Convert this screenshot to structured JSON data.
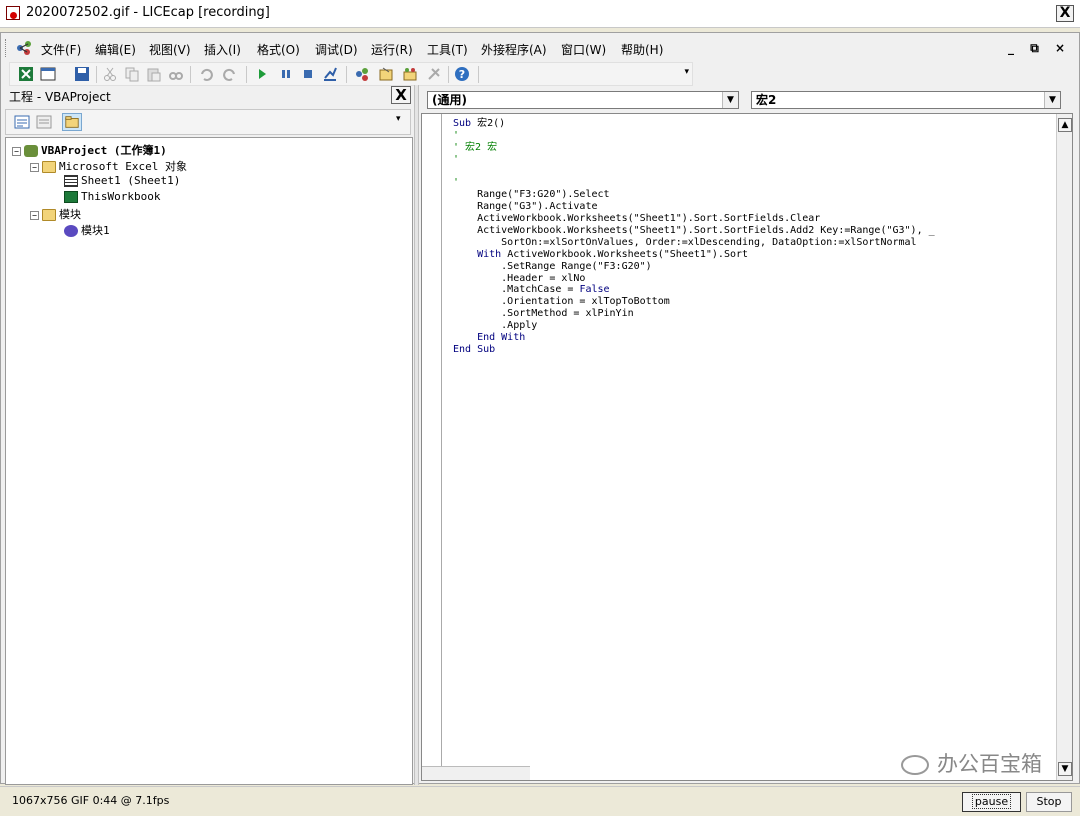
{
  "window": {
    "title": "2020072502.gif - LICEcap [recording]",
    "close_glyph": "X"
  },
  "menubar": {
    "items": [
      "文件(F)",
      "编辑(E)",
      "视图(V)",
      "插入(I)",
      "格式(O)",
      "调试(D)",
      "运行(R)",
      "工具(T)",
      "外接程序(A)",
      "窗口(W)",
      "帮助(H)"
    ],
    "mdi_controls": "_ ⧉ ×"
  },
  "toolbar": {
    "icons": [
      "excel-icon",
      "insert-module-icon",
      "save-icon",
      "cut-icon",
      "copy-icon",
      "paste-icon",
      "find-icon",
      "undo-icon",
      "redo-icon",
      "run-icon",
      "break-icon",
      "reset-icon",
      "design-mode-icon",
      "project-explorer-icon",
      "properties-icon",
      "object-browser-icon",
      "toolbox-icon",
      "help-icon"
    ]
  },
  "project": {
    "title": "工程 - VBAProject",
    "close_glyph": "X",
    "tree": {
      "root": "VBAProject (工作簿1)",
      "excel_objects": "Microsoft Excel 对象",
      "sheet1": "Sheet1 (Sheet1)",
      "thisworkbook": "ThisWorkbook",
      "modules": "模块",
      "module1": "模块1"
    }
  },
  "code_window": {
    "object_combo": "(通用)",
    "proc_combo": "宏2",
    "lines": [
      {
        "t": "Sub 宏2()",
        "k": "sub"
      },
      {
        "t": "'",
        "k": "cm"
      },
      {
        "t": "' 宏2 宏",
        "k": "cm"
      },
      {
        "t": "'",
        "k": "cm"
      },
      {
        "t": "",
        "k": ""
      },
      {
        "t": "'",
        "k": "cm"
      },
      {
        "t": "    Range(\"F3:G20\").Select",
        "k": ""
      },
      {
        "t": "    Range(\"G3\").Activate",
        "k": ""
      },
      {
        "t": "    ActiveWorkbook.Worksheets(\"Sheet1\").Sort.SortFields.Clear",
        "k": ""
      },
      {
        "t": "    ActiveWorkbook.Worksheets(\"Sheet1\").Sort.SortFields.Add2 Key:=Range(\"G3\"), _",
        "k": ""
      },
      {
        "t": "        SortOn:=xlSortOnValues, Order:=xlDescending, DataOption:=xlSortNormal",
        "k": ""
      },
      {
        "t": "    With ActiveWorkbook.Worksheets(\"Sheet1\").Sort",
        "k": "with"
      },
      {
        "t": "        .SetRange Range(\"F3:G20\")",
        "k": ""
      },
      {
        "t": "        .Header = xlNo",
        "k": ""
      },
      {
        "t": "        .MatchCase = False",
        "k": "false"
      },
      {
        "t": "        .Orientation = xlTopToBottom",
        "k": ""
      },
      {
        "t": "        .SortMethod = xlPinYin",
        "k": ""
      },
      {
        "t": "        .Apply",
        "k": ""
      },
      {
        "t": "    End With",
        "k": "endwith"
      },
      {
        "t": "End Sub",
        "k": "kwline"
      }
    ]
  },
  "watermark": "办公百宝箱",
  "status": {
    "info": "1067x756 GIF 0:44 @ 7.1fps",
    "pause_label": "pause",
    "stop_label": "Stop"
  },
  "colors": {
    "keyword": "#00007f",
    "comment": "#007f00"
  }
}
